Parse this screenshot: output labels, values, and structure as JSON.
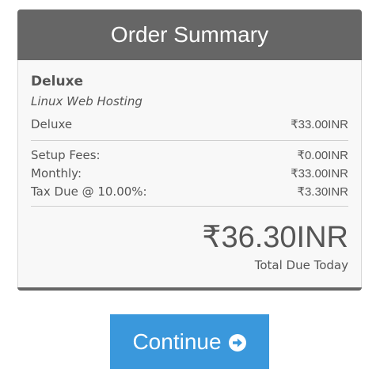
{
  "header": {
    "title": "Order Summary"
  },
  "product": {
    "name": "Deluxe",
    "group": "Linux Web Hosting",
    "line_label": "Deluxe",
    "line_amount": "₹33.00INR"
  },
  "fees": [
    {
      "label": "Setup Fees:",
      "amount": "₹0.00INR"
    },
    {
      "label": "Monthly:",
      "amount": "₹33.00INR"
    },
    {
      "label": "Tax Due @ 10.00%:",
      "amount": "₹3.30INR"
    }
  ],
  "total": {
    "amount": "₹36.30INR",
    "label": "Total Due Today"
  },
  "actions": {
    "continue_label": "Continue",
    "continue_icon": "arrow-circle-right-icon"
  },
  "colors": {
    "header_bg": "#666666",
    "button_bg": "#3a98dc",
    "panel_bg": "#f8f8f8"
  }
}
